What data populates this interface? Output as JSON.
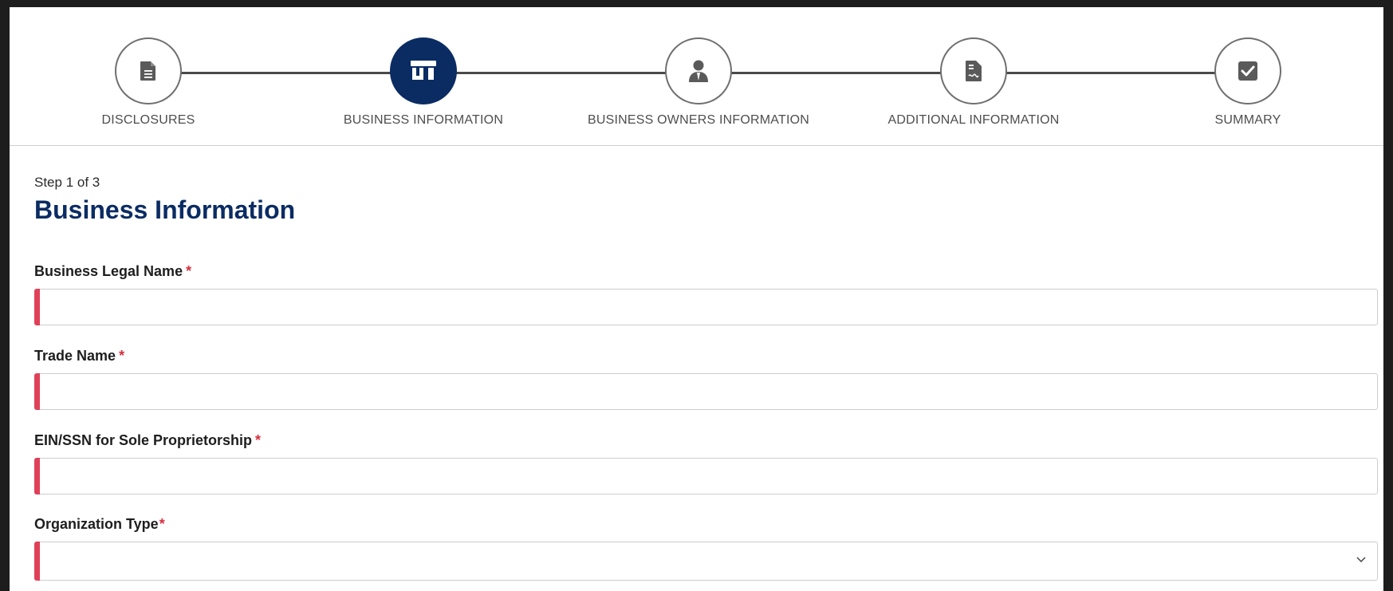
{
  "stepper": {
    "steps": [
      {
        "label": "DISCLOSURES",
        "icon": "document-icon",
        "active": false
      },
      {
        "label": "BUSINESS INFORMATION",
        "icon": "storefront-icon",
        "active": true
      },
      {
        "label": "BUSINESS OWNERS INFORMATION",
        "icon": "person-suit-icon",
        "active": false
      },
      {
        "label": "ADDITIONAL INFORMATION",
        "icon": "signed-document-icon",
        "active": false
      },
      {
        "label": "SUMMARY",
        "icon": "checkbox-icon",
        "active": false
      }
    ]
  },
  "form": {
    "step_count": "Step 1 of 3",
    "title": "Business Information",
    "fields": [
      {
        "label": "Business Legal Name",
        "required": "*",
        "value": ""
      },
      {
        "label": "Trade Name",
        "required": "*",
        "value": ""
      },
      {
        "label": "EIN/SSN for Sole Proprietorship",
        "required": "*",
        "value": ""
      },
      {
        "label": "Organization Type",
        "required": "*",
        "value": ""
      }
    ]
  },
  "colors": {
    "primary": "#0b2c63",
    "required_indicator": "#e04058",
    "step_line": "#4a4a4a"
  }
}
